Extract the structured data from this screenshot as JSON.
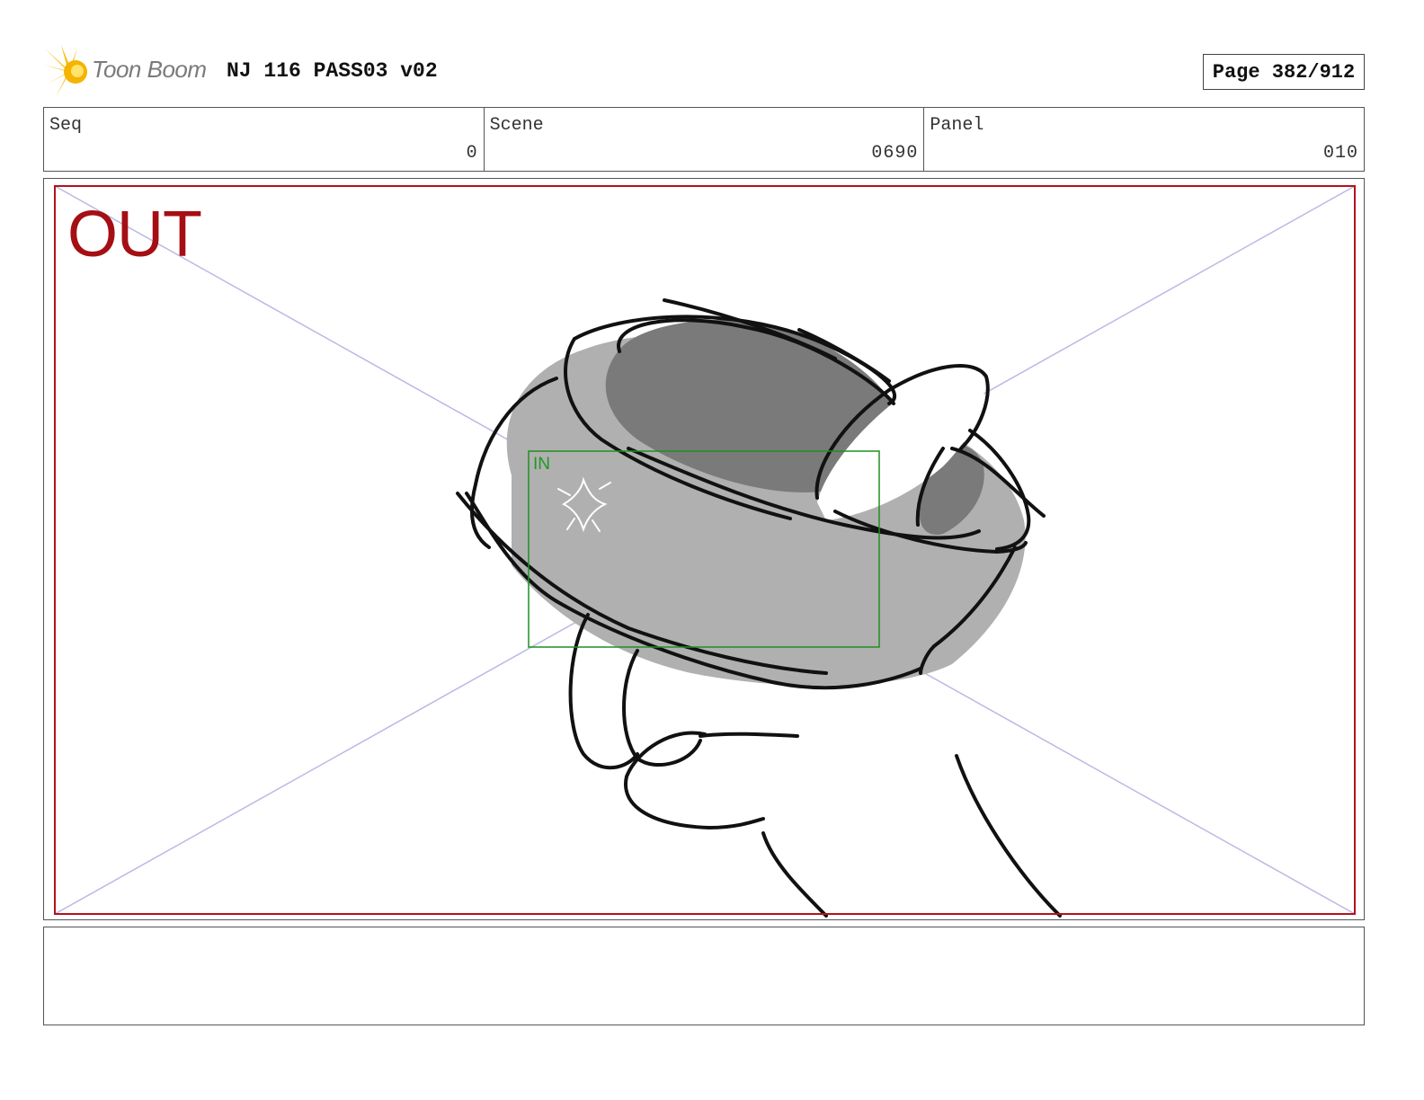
{
  "header": {
    "logo_text": "Toon Boom",
    "title": "NJ 116 PASS03 v02",
    "page_label": "Page 382/912"
  },
  "info": {
    "seq": {
      "label": "Seq",
      "value": "0"
    },
    "scene": {
      "label": "Scene",
      "value": "0690"
    },
    "panel": {
      "label": "Panel",
      "value": "010"
    }
  },
  "frame": {
    "out_label": "OUT",
    "in_label": "IN",
    "colors": {
      "out_border": "#b3121c",
      "in_border": "#1f8f1f",
      "guides": "#b9b9e6"
    }
  },
  "icons": {
    "logo": "toon-boom-star-icon"
  },
  "notes": {
    "text": ""
  }
}
